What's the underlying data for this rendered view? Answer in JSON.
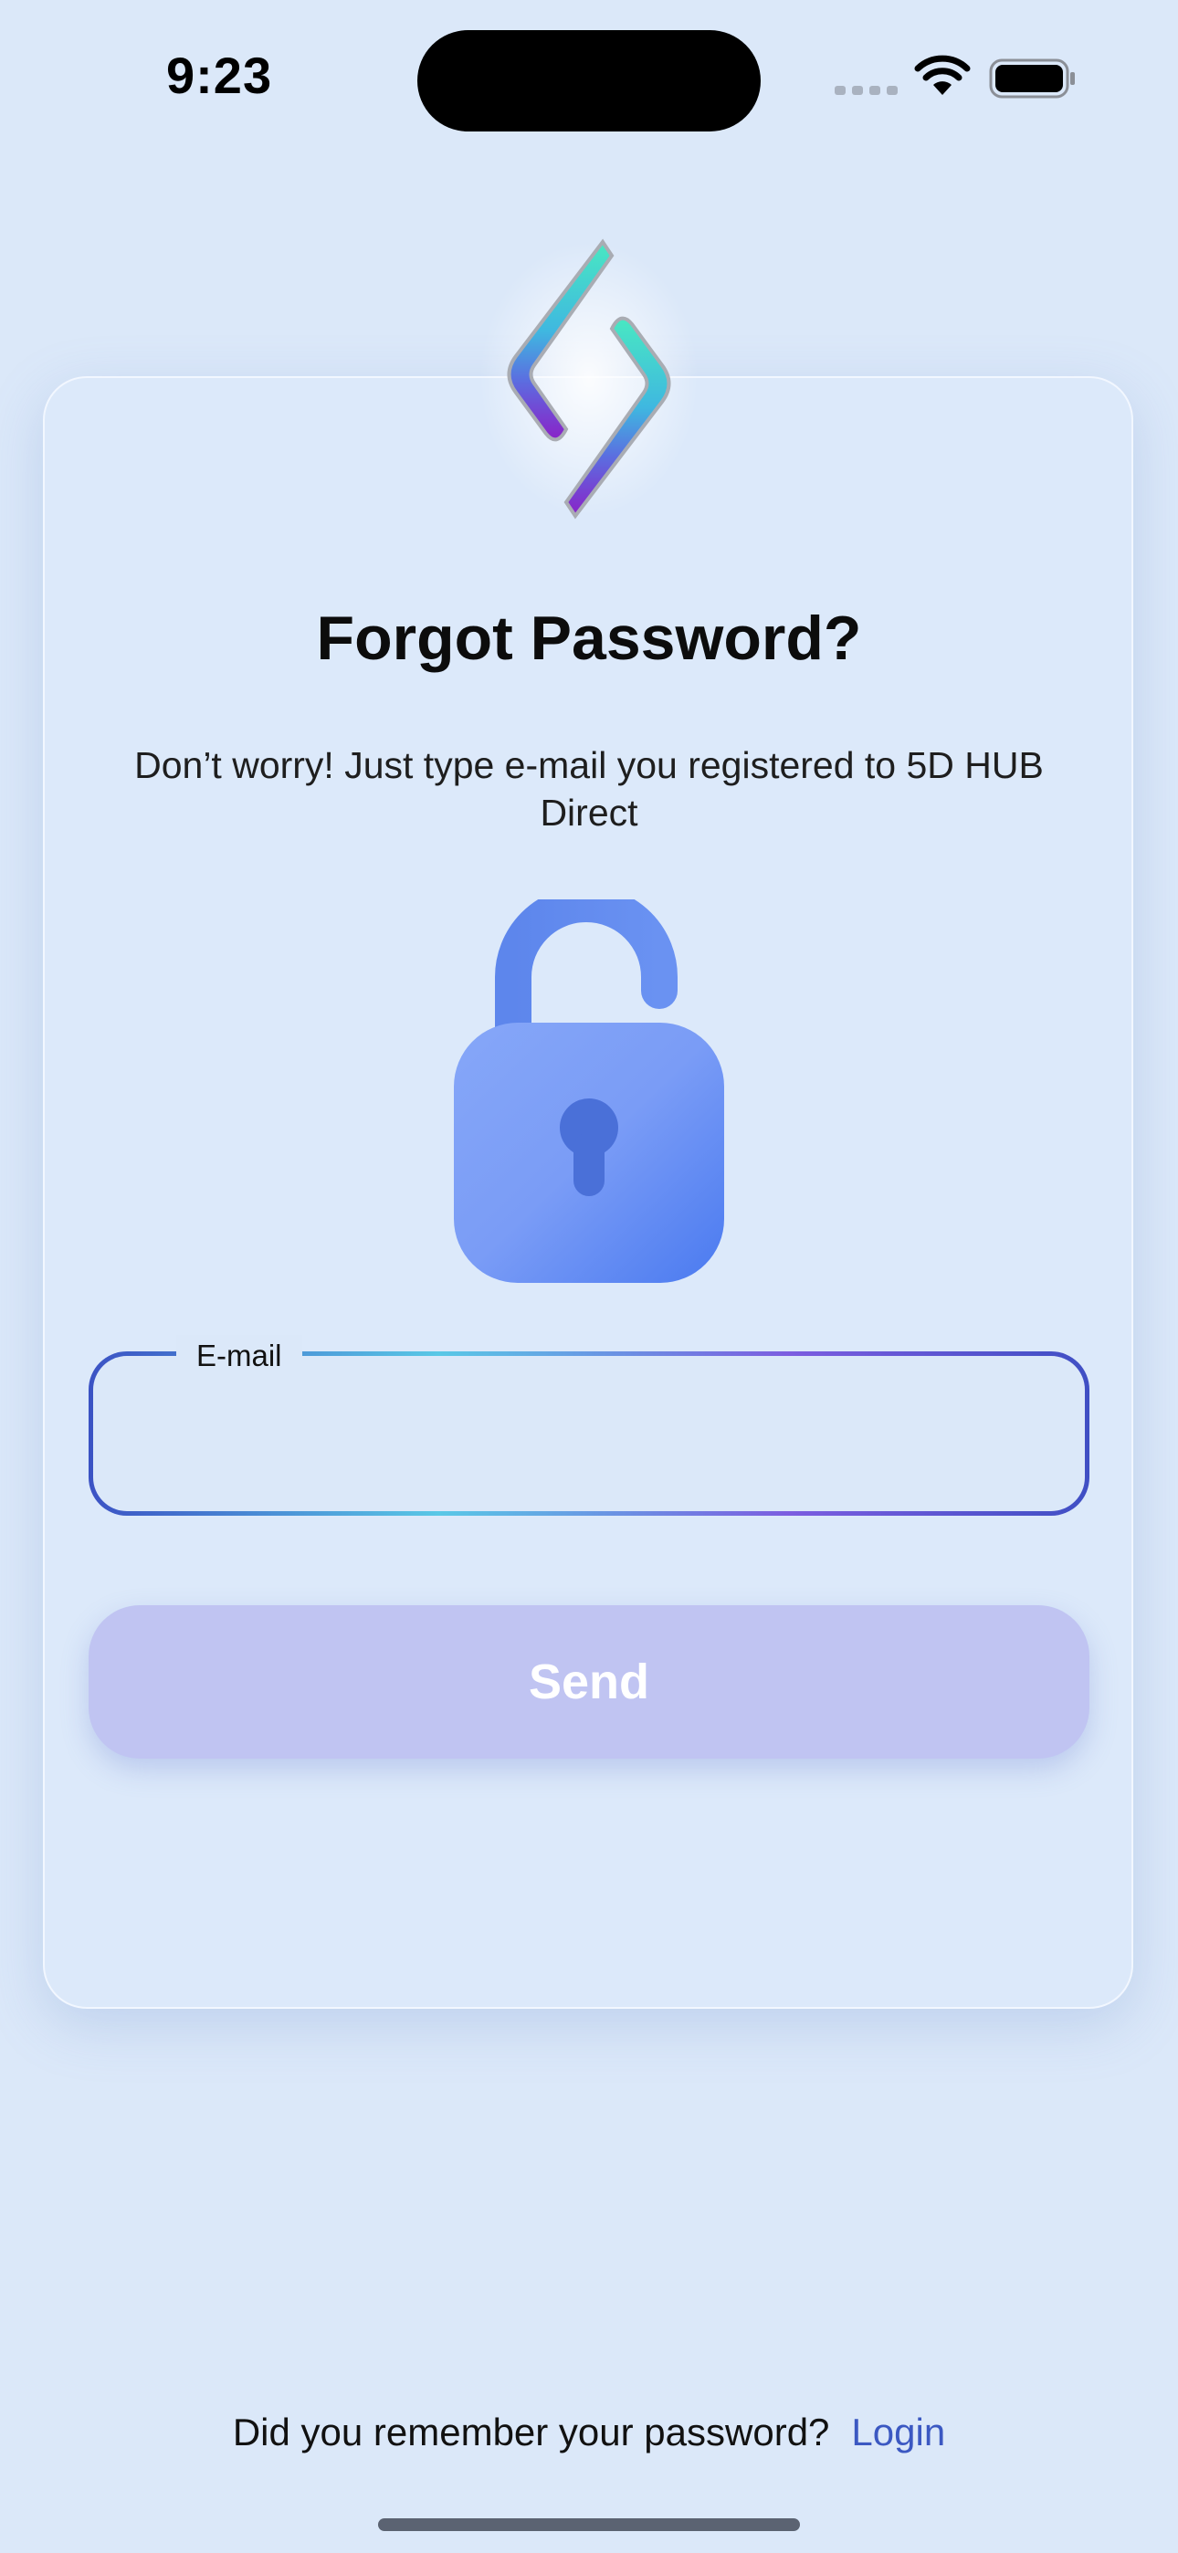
{
  "status_bar": {
    "time": "9:23"
  },
  "logo": {
    "icon": "app-logo-icon"
  },
  "forgot": {
    "title": "Forgot Password?",
    "subtitle": "Don’t worry! Just type e-mail you registered to 5D HUB Direct",
    "illustration": "unlocked-padlock-icon"
  },
  "email_field": {
    "label": "E-mail",
    "value": "",
    "placeholder": ""
  },
  "send_button": {
    "label": "Send",
    "state": "disabled"
  },
  "footer": {
    "prompt": "Did you remember your password?",
    "login_label": "Login"
  },
  "colors": {
    "background": "#dbe8f9",
    "accent": "#3b58c2",
    "button_disabled": "#c0c4f2"
  }
}
